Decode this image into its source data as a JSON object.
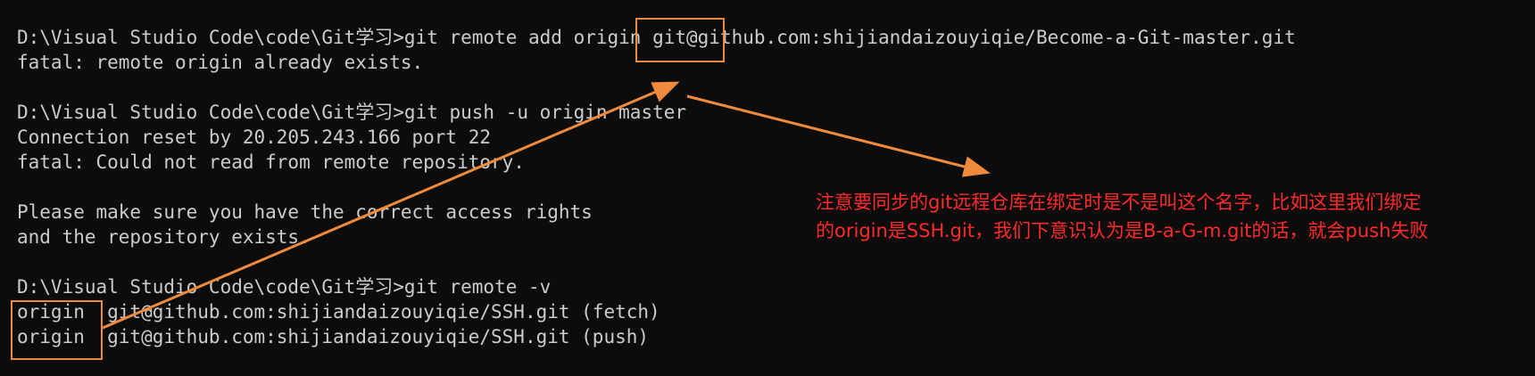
{
  "terminal": {
    "lines": [
      "D:\\Visual Studio Code\\code\\Git学习>git remote add origin git@github.com:shijiandaizouyiqie/Become-a-Git-master.git",
      "fatal: remote origin already exists.",
      "",
      "D:\\Visual Studio Code\\code\\Git学习>git push -u origin master",
      "Connection reset by 20.205.243.166 port 22",
      "fatal: Could not read from remote repository.",
      "",
      "Please make sure you have the correct access rights",
      "and the repository exists.",
      "",
      "D:\\Visual Studio Code\\code\\Git学习>git remote -v",
      "origin  git@github.com:shijiandaizouyiqie/SSH.git (fetch)",
      "origin  git@github.com:shijiandaizouyiqie/SSH.git (push)"
    ]
  },
  "annotation": {
    "line1": "注意要同步的git远程仓库在绑定时是不是叫这个名字，比如这里我们绑定",
    "line2": "的origin是SSH.git，我们下意识认为是B-a-G-m.git的话，就会push失败"
  },
  "colors": {
    "background": "#0c0c0c",
    "text": "#cccccc",
    "annotation": "#ff2a2a",
    "highlight": "#f08a3c"
  }
}
